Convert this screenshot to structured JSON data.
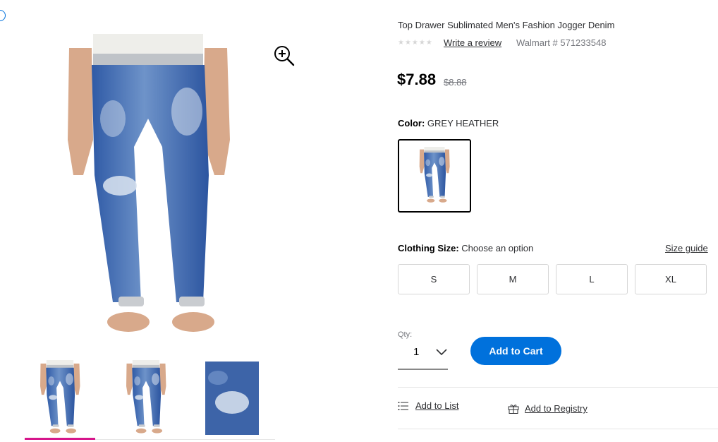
{
  "product": {
    "title": "Top Drawer Sublimated Men's Fashion Jogger Denim",
    "rating_stars": "★★★★★",
    "write_review_label": "Write a review",
    "item_number": "Walmart # 571233548",
    "price": "$7.88",
    "was_price": "$8.88"
  },
  "color": {
    "label": "Color:",
    "value": "GREY HEATHER"
  },
  "size": {
    "label": "Clothing Size:",
    "value": "Choose an option",
    "guide_label": "Size guide",
    "options": [
      "S",
      "M",
      "L",
      "XL"
    ]
  },
  "quantity": {
    "label": "Qty:",
    "value": "1"
  },
  "actions": {
    "add_to_cart": "Add to Cart",
    "add_to_list": "Add to List",
    "add_to_registry": "Add to Registry"
  },
  "icons": {
    "zoom": "zoom-in-icon",
    "chevron": "chevron-down-icon",
    "list": "list-icon",
    "registry": "gift-icon"
  },
  "colors": {
    "accent": "#0071dc",
    "thumb_active": "#d6168b",
    "denim": "#3d64a8"
  }
}
